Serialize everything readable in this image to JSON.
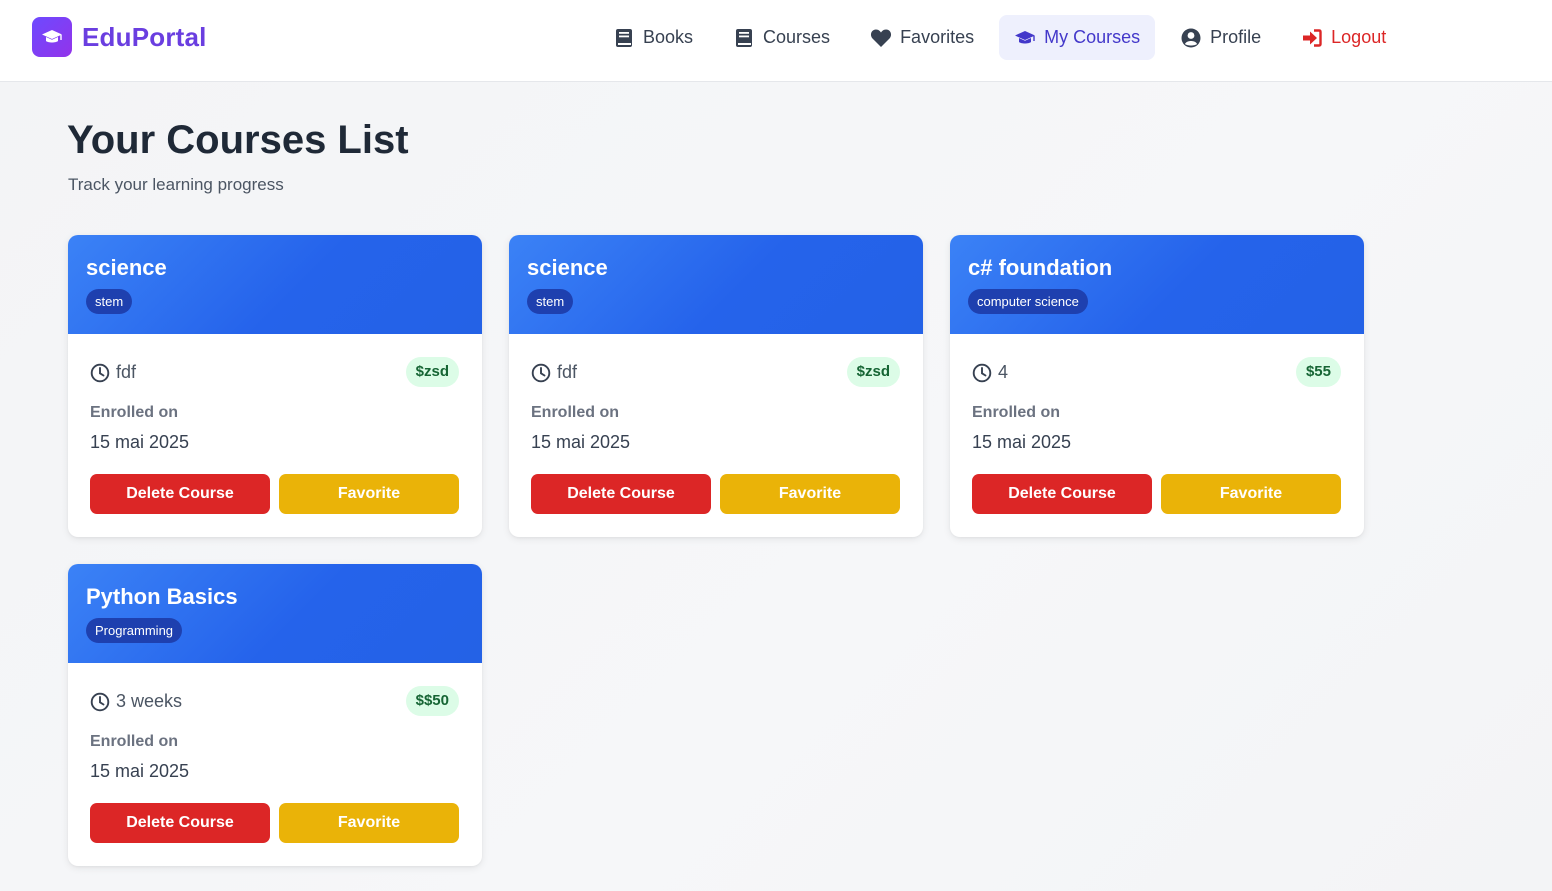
{
  "app": {
    "name": "EduPortal",
    "logo_icon": "graduation-cap-icon",
    "brand_color": "#6a3ee0"
  },
  "nav": {
    "items": [
      {
        "label": "Books",
        "icon": "book-icon"
      },
      {
        "label": "Courses",
        "icon": "book-icon"
      },
      {
        "label": "Favorites",
        "icon": "heart-icon"
      },
      {
        "label": "My Courses",
        "icon": "graduation-cap-icon",
        "active": true
      },
      {
        "label": "Profile",
        "icon": "user-circle-icon"
      },
      {
        "label": "Logout",
        "icon": "sign-out-icon",
        "color": "#dc2626"
      }
    ]
  },
  "page": {
    "title": "Your Courses List",
    "subtitle": "Track your learning progress"
  },
  "courses": [
    {
      "title": "science",
      "category": "stem",
      "duration": "fdf",
      "price": "$zsd",
      "enrolled_label": "Enrolled on",
      "enrolled_date": "15 mai 2025",
      "delete_label": "Delete Course",
      "favorite_label": "Favorite"
    },
    {
      "title": "science",
      "category": "stem",
      "duration": "fdf",
      "price": "$zsd",
      "enrolled_label": "Enrolled on",
      "enrolled_date": "15 mai 2025",
      "delete_label": "Delete Course",
      "favorite_label": "Favorite"
    },
    {
      "title": "c# foundation",
      "category": "computer science",
      "duration": "4",
      "price": "$55",
      "enrolled_label": "Enrolled on",
      "enrolled_date": "15 mai 2025",
      "delete_label": "Delete Course",
      "favorite_label": "Favorite"
    },
    {
      "title": "Python Basics",
      "category": "Programming",
      "duration": "3 weeks",
      "price": "$$50",
      "enrolled_label": "Enrolled on",
      "enrolled_date": "15 mai 2025",
      "delete_label": "Delete Course",
      "favorite_label": "Favorite"
    }
  ],
  "colors": {
    "header_blue": "#2563eb",
    "tag_blue": "#1e40af",
    "delete_red": "#dc2626",
    "favorite_yellow": "#eab308",
    "price_green_bg": "#dcfce7",
    "price_green_text": "#166534"
  }
}
